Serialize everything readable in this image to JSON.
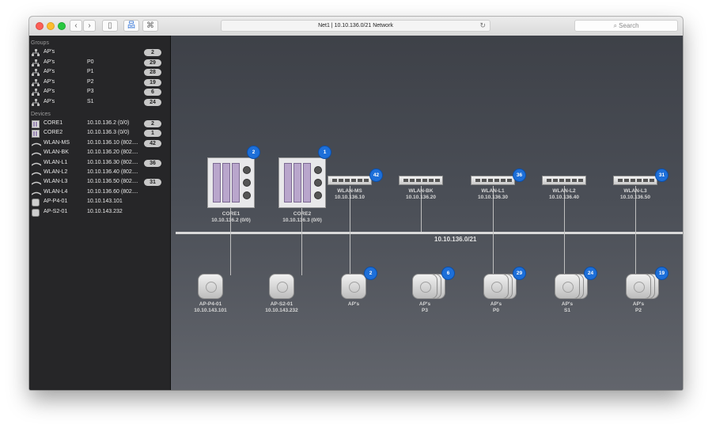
{
  "titlebar": {
    "title": "Net1  |  10.10.136.0/21 Network",
    "search_placeholder": "Search",
    "back_glyph": "‹",
    "forward_glyph": "›",
    "reload_glyph": "↻",
    "sidebar_glyph": "▯",
    "topology_glyph": "品",
    "command_glyph": "⌘"
  },
  "sidebar": {
    "groups_header": "Groups",
    "groups": [
      {
        "name": "AP's",
        "sub": "",
        "count": "2",
        "icon": "group-icon"
      },
      {
        "name": "AP's",
        "sub": "P0",
        "count": "29",
        "icon": "group-icon"
      },
      {
        "name": "AP's",
        "sub": "P1",
        "count": "28",
        "icon": "group-icon"
      },
      {
        "name": "AP's",
        "sub": "P2",
        "count": "19",
        "icon": "group-icon"
      },
      {
        "name": "AP's",
        "sub": "P3",
        "count": "6",
        "icon": "group-icon"
      },
      {
        "name": "AP's",
        "sub": "S1",
        "count": "24",
        "icon": "group-icon"
      }
    ],
    "devices_header": "Devices",
    "devices": [
      {
        "name": "CORE1",
        "sub": "10.10.136.2 (0/0)",
        "count": "2",
        "icon": "chassis-icon"
      },
      {
        "name": "CORE2",
        "sub": "10.10.136.3 (0/0)",
        "count": "1",
        "icon": "chassis-icon"
      },
      {
        "name": "WLAN-MS",
        "sub": "10.10.136.10 (802....",
        "count": "42",
        "icon": "switch-icon"
      },
      {
        "name": "WLAN-BK",
        "sub": "10.10.136.20 (802....",
        "count": "",
        "icon": "switch-icon"
      },
      {
        "name": "WLAN-L1",
        "sub": "10.10.136.30 (802....",
        "count": "36",
        "icon": "switch-icon"
      },
      {
        "name": "WLAN-L2",
        "sub": "10.10.136.40 (802....",
        "count": "",
        "icon": "switch-icon"
      },
      {
        "name": "WLAN-L3",
        "sub": "10.10.136.50 (802....",
        "count": "31",
        "icon": "switch-icon"
      },
      {
        "name": "WLAN-L4",
        "sub": "10.10.136.60 (802....",
        "count": "",
        "icon": "switch-icon"
      },
      {
        "name": "AP-P4-01",
        "sub": "10.10.143.101",
        "count": "",
        "icon": "access-point-icon"
      },
      {
        "name": "AP-S2-01",
        "sub": "10.10.143.232",
        "count": "",
        "icon": "access-point-icon"
      }
    ]
  },
  "network": {
    "bus_label": "10.10.136.0/21",
    "cores": [
      {
        "name": "CORE1",
        "ip": "10.10.136.2 (0/0)",
        "badge": "2"
      },
      {
        "name": "CORE2",
        "ip": "10.10.136.3 (0/0)",
        "badge": "1"
      }
    ],
    "switches": [
      {
        "name": "WLAN-MS",
        "ip": "10.10.136.10",
        "badge": "42"
      },
      {
        "name": "WLAN-BK",
        "ip": "10.10.136.20",
        "badge": ""
      },
      {
        "name": "WLAN-L1",
        "ip": "10.10.136.30",
        "badge": "36"
      },
      {
        "name": "WLAN-L2",
        "ip": "10.10.136.40",
        "badge": ""
      },
      {
        "name": "WLAN-L3",
        "ip": "10.10.136.50",
        "badge": "31"
      }
    ],
    "aps": [
      {
        "name": "AP-P4-01",
        "sub": "10.10.143.101",
        "badge": ""
      },
      {
        "name": "AP-S2-01",
        "sub": "10.10.143.232",
        "badge": ""
      },
      {
        "name": "AP's",
        "sub": "",
        "badge": "2"
      },
      {
        "name": "AP's",
        "sub": "P3",
        "badge": "6"
      },
      {
        "name": "AP's",
        "sub": "P0",
        "badge": "29"
      },
      {
        "name": "AP's",
        "sub": "S1",
        "badge": "24"
      },
      {
        "name": "AP's",
        "sub": "P2",
        "badge": "19"
      }
    ]
  }
}
